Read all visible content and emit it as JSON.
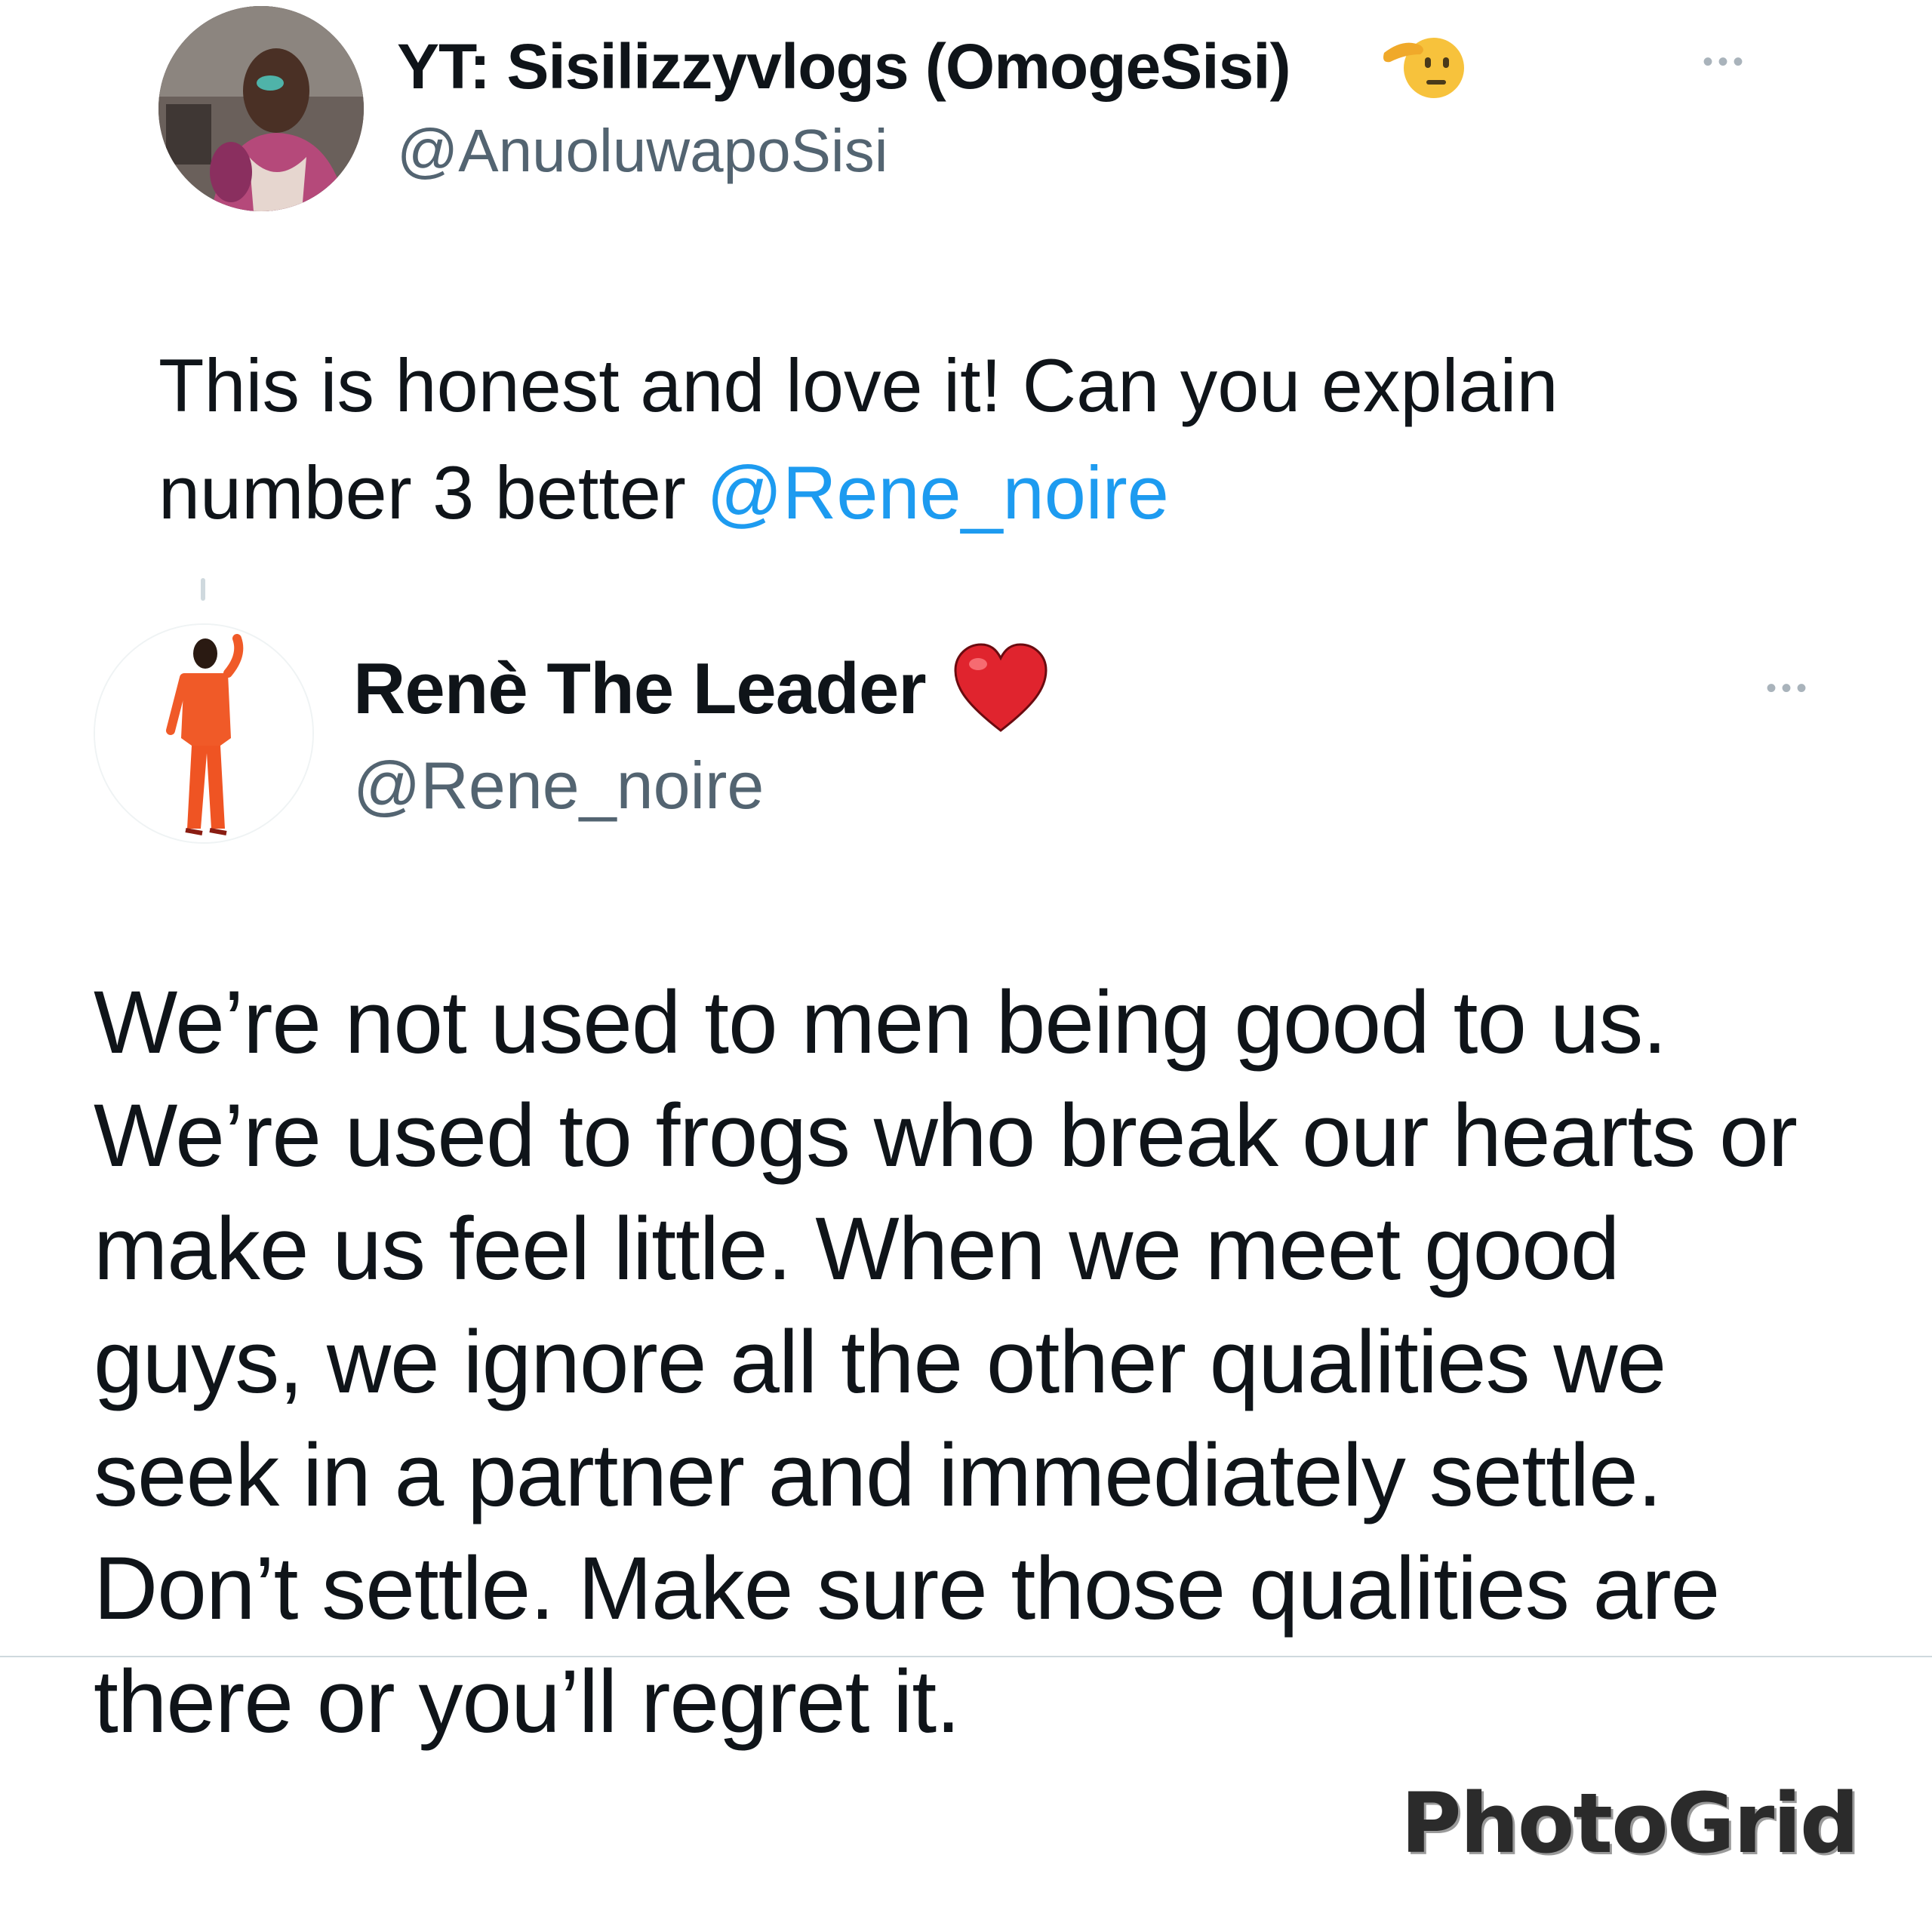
{
  "tweets": [
    {
      "display_name": "YT: Sisilizzyvlogs (OmogeSisi)",
      "name_emoji": "saluting-face",
      "handle": "@AnuoluwapoSisi",
      "body_text": "This is honest and love it! Can you explain number 3 better ",
      "mention": "@Rene_noire",
      "more": "•••"
    },
    {
      "display_name": "Renè The Leader",
      "name_emoji": "red-heart",
      "handle": "@Rene_noire",
      "body_text": "We’re not used to men being good to us. We’re used to frogs who break our hearts or make us feel little. When we meet good guys, we ignore all the other qualities we seek in a partner and immediately settle. Don’t settle. Make sure those qualities are there or you’ll regret it.",
      "more": "•••"
    }
  ],
  "watermark": "PhotoGrid",
  "colors": {
    "text": "#0f1419",
    "secondary": "#536471",
    "link": "#1d9bf0",
    "divider": "#cfd9de",
    "heart": "#e0242e"
  }
}
